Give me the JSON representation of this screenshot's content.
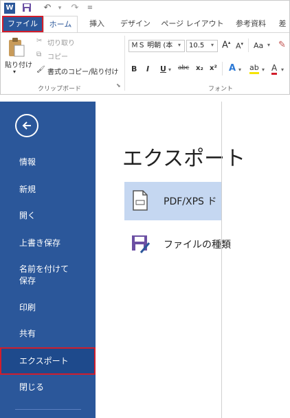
{
  "quick_access": {
    "app_icon": "word-icon",
    "save_icon": "save-icon",
    "undo_icon": "undo-icon",
    "redo_icon": "redo-icon",
    "customize_icon": "customize-qat-icon"
  },
  "tabs": [
    {
      "label": "ファイル"
    },
    {
      "label": "ホーム"
    },
    {
      "label": "挿入"
    },
    {
      "label": "デザイン"
    },
    {
      "label": "ページ レイアウト"
    },
    {
      "label": "参考資料"
    },
    {
      "label": "差"
    }
  ],
  "clipboard": {
    "paste_label": "貼り付け",
    "cut_label": "切り取り",
    "copy_label": "コピー",
    "format_painter_label": "書式のコピー/貼り付け",
    "group_label": "クリップボード"
  },
  "font": {
    "name": "ＭＳ 明朝 (本",
    "size": "10.5",
    "case_label": "Aa",
    "group_label": "フォント",
    "buttons": [
      "B",
      "I",
      "U",
      "abc",
      "x₂",
      "x²"
    ]
  },
  "backstage": {
    "title": "エクスポート",
    "nav": [
      {
        "label": "情報"
      },
      {
        "label": "新規"
      },
      {
        "label": "開く"
      },
      {
        "label": "上書き保存"
      },
      {
        "label": "名前を付けて\n保存"
      },
      {
        "label": "印刷"
      },
      {
        "label": "共有"
      },
      {
        "label": "エクスポート"
      },
      {
        "label": "閉じる"
      }
    ],
    "options": [
      {
        "label": "PDF/XPS ド",
        "icon": "pdf-document-icon"
      },
      {
        "label": "ファイルの種類",
        "icon": "file-type-save-icon"
      }
    ]
  },
  "colors": {
    "accent": "#2b579a",
    "highlight": "#d21d2b",
    "selected_option": "#c5d7f1"
  }
}
